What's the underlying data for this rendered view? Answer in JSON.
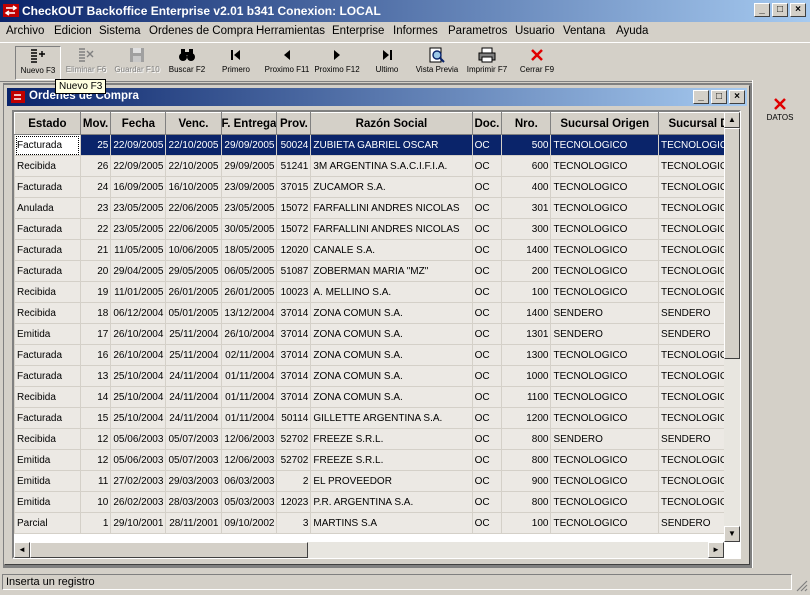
{
  "window": {
    "title": "CheckOUT Backoffice Enterprise v2.01 b341 Conexion: LOCAL"
  },
  "menu": [
    "Archivo",
    "Edicion",
    "Sistema",
    "Ordenes de Compra",
    "Herramientas",
    "Enterprise",
    "Informes",
    "Parametros",
    "Usuario",
    "Ventana",
    "Ayuda"
  ],
  "toolbar": {
    "nuevo": "Nuevo F3",
    "eliminar": "Eliminar F6",
    "guardar": "Guardar F10",
    "buscar": "Buscar F2",
    "primero": "Primero",
    "proximo11": "Proximo F11",
    "proximo12": "Proximo F12",
    "ultimo": "Ultimo",
    "vista": "Vista Previa",
    "imprimir": "Imprimir F7",
    "cerrar": "Cerrar F9"
  },
  "tooltip": "Nuevo F3",
  "child": {
    "title": "Ordenes de Compra"
  },
  "side": {
    "datos": "DATOS"
  },
  "status": "Inserta un registro",
  "table": {
    "headers": [
      "Estado",
      "Mov.",
      "Fecha",
      "Venc.",
      "F. Entrega",
      "Prov.",
      "Razón Social",
      "Doc.",
      "Nro.",
      "Sucursal Origen",
      "Sucursal D"
    ],
    "rows": [
      [
        "Facturada",
        "25",
        "22/09/2005",
        "22/10/2005",
        "29/09/2005",
        "50024",
        "ZUBIETA GABRIEL OSCAR",
        "OC",
        "500",
        "TECNOLOGICO",
        "TECNOLOGICO"
      ],
      [
        "Recibida",
        "26",
        "22/09/2005",
        "22/10/2005",
        "29/09/2005",
        "51241",
        "3M ARGENTINA S.A.C.I.F.I.A.",
        "OC",
        "600",
        "TECNOLOGICO",
        "TECNOLOGICO"
      ],
      [
        "Facturada",
        "24",
        "16/09/2005",
        "16/10/2005",
        "23/09/2005",
        "37015",
        "ZUCAMOR S.A.",
        "OC",
        "400",
        "TECNOLOGICO",
        "TECNOLOGICO"
      ],
      [
        "Anulada",
        "23",
        "23/05/2005",
        "22/06/2005",
        "23/05/2005",
        "15072",
        "FARFALLINI ANDRES NICOLAS",
        "OC",
        "301",
        "TECNOLOGICO",
        "TECNOLOGICO"
      ],
      [
        "Facturada",
        "22",
        "23/05/2005",
        "22/06/2005",
        "30/05/2005",
        "15072",
        "FARFALLINI ANDRES NICOLAS",
        "OC",
        "300",
        "TECNOLOGICO",
        "TECNOLOGICO"
      ],
      [
        "Facturada",
        "21",
        "11/05/2005",
        "10/06/2005",
        "18/05/2005",
        "12020",
        "CANALE S.A.",
        "OC",
        "1400",
        "TECNOLOGICO",
        "TECNOLOGICO"
      ],
      [
        "Facturada",
        "20",
        "29/04/2005",
        "29/05/2005",
        "06/05/2005",
        "51087",
        "ZOBERMAN MARIA \"MZ\"",
        "OC",
        "200",
        "TECNOLOGICO",
        "TECNOLOGICO"
      ],
      [
        "Recibida",
        "19",
        "11/01/2005",
        "26/01/2005",
        "26/01/2005",
        "10023",
        "A. MELLINO S.A.",
        "OC",
        "100",
        "TECNOLOGICO",
        "TECNOLOGICO"
      ],
      [
        "Recibida",
        "18",
        "06/12/2004",
        "05/01/2005",
        "13/12/2004",
        "37014",
        "ZONA COMUN S.A.",
        "OC",
        "1400",
        "SENDERO",
        "SENDERO"
      ],
      [
        "Emitida",
        "17",
        "26/10/2004",
        "25/11/2004",
        "26/10/2004",
        "37014",
        "ZONA COMUN S.A.",
        "OC",
        "1301",
        "SENDERO",
        "SENDERO"
      ],
      [
        "Facturada",
        "16",
        "26/10/2004",
        "25/11/2004",
        "02/11/2004",
        "37014",
        "ZONA COMUN S.A.",
        "OC",
        "1300",
        "TECNOLOGICO",
        "TECNOLOGICO"
      ],
      [
        "Facturada",
        "13",
        "25/10/2004",
        "24/11/2004",
        "01/11/2004",
        "37014",
        "ZONA COMUN S.A.",
        "OC",
        "1000",
        "TECNOLOGICO",
        "TECNOLOGICO"
      ],
      [
        "Recibida",
        "14",
        "25/10/2004",
        "24/11/2004",
        "01/11/2004",
        "37014",
        "ZONA COMUN S.A.",
        "OC",
        "1100",
        "TECNOLOGICO",
        "TECNOLOGICO"
      ],
      [
        "Facturada",
        "15",
        "25/10/2004",
        "24/11/2004",
        "01/11/2004",
        "50114",
        "GILLETTE ARGENTINA S.A.",
        "OC",
        "1200",
        "TECNOLOGICO",
        "TECNOLOGICO"
      ],
      [
        "Recibida",
        "12",
        "05/06/2003",
        "05/07/2003",
        "12/06/2003",
        "52702",
        "FREEZE S.R.L.",
        "OC",
        "800",
        "SENDERO",
        "SENDERO"
      ],
      [
        "Emitida",
        "12",
        "05/06/2003",
        "05/07/2003",
        "12/06/2003",
        "52702",
        "FREEZE S.R.L.",
        "OC",
        "800",
        "TECNOLOGICO",
        "TECNOLOGICO"
      ],
      [
        "Emitida",
        "11",
        "27/02/2003",
        "29/03/2003",
        "06/03/2003",
        "2",
        "EL PROVEEDOR",
        "OC",
        "900",
        "TECNOLOGICO",
        "TECNOLOGICO"
      ],
      [
        "Emitida",
        "10",
        "26/02/2003",
        "28/03/2003",
        "05/03/2003",
        "12023",
        "P.R. ARGENTINA S.A.",
        "OC",
        "800",
        "TECNOLOGICO",
        "TECNOLOGICO"
      ],
      [
        "Parcial",
        "1",
        "29/10/2001",
        "28/11/2001",
        "09/10/2002",
        "3",
        "MARTINS S.A",
        "OC",
        "100",
        "TECNOLOGICO",
        "SENDERO"
      ]
    ]
  }
}
